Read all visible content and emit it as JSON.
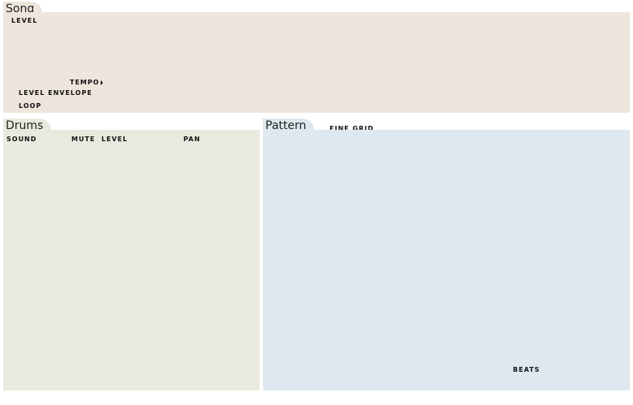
{
  "colors": {
    "song_bg": "#eee5dc",
    "drums_bg": "#eae9df",
    "pattern_bg": "#dee8ee"
  },
  "song": {
    "title": "Song",
    "level_label": "LEVEL",
    "tempo_label": "TEMPO",
    "tempo_icon": "triangle-right-icon",
    "level_envelope_label": "LEVEL ENVELOPE",
    "loop_label": "LOOP"
  },
  "drums": {
    "title": "Drums",
    "columns": {
      "sound": "SOUND",
      "mute": "MUTE",
      "level": "LEVEL",
      "pan": "PAN"
    }
  },
  "pattern": {
    "title": "Pattern",
    "fine_grid_label": "FINE GRID",
    "beats_label": "BEATS"
  }
}
